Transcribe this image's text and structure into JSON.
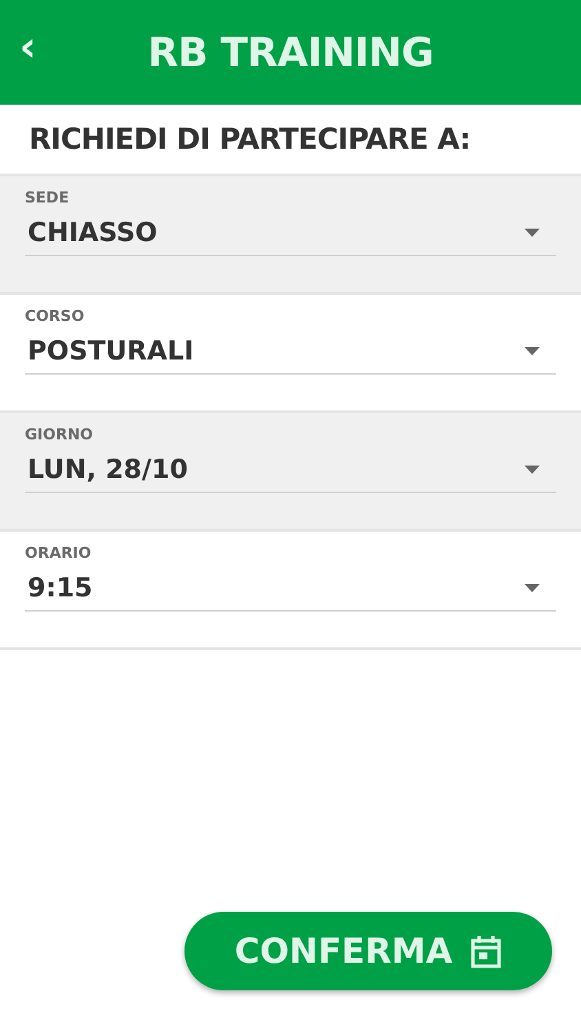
{
  "header": {
    "back": "‹",
    "title": "RB TRAINING"
  },
  "heading": "RICHIEDI DI PARTECIPARE A:",
  "fields": [
    {
      "label": "SEDE",
      "value": "CHIASSO"
    },
    {
      "label": "CORSO",
      "value": "POSTURALI"
    },
    {
      "label": "GIORNO",
      "value": "LUN, 28/10"
    },
    {
      "label": "ORARIO",
      "value": "9:15"
    }
  ],
  "confirm_button": "CONFERMA"
}
